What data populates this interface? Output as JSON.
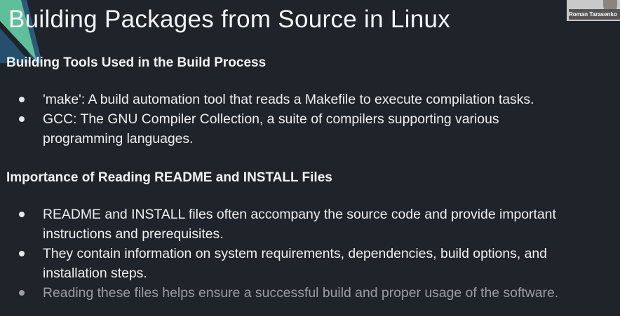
{
  "slide": {
    "title": "Building Packages from Source in Linux",
    "accent_color": "#5fbf9a",
    "sections": [
      {
        "heading": "Building Tools Used in the Build Process",
        "bullets": [
          {
            "lines": [
              "'make': A build automation tool that reads a Makefile to execute compilation tasks."
            ]
          },
          {
            "lines": [
              "GCC: The GNU Compiler Collection, a suite of compilers supporting various",
              "programming languages."
            ]
          }
        ]
      },
      {
        "heading": "Importance of Reading README and INSTALL Files",
        "bullets": [
          {
            "lines": [
              "README and INSTALL files often accompany the source code and provide important",
              "instructions and prerequisites."
            ]
          },
          {
            "lines": [
              "They contain information on system requirements, dependencies, build options, and",
              "installation steps."
            ]
          },
          {
            "lines": [
              "Reading these files helps ensure a successful build and proper usage of the software."
            ]
          }
        ]
      }
    ]
  },
  "video_overlay": {
    "participant_name": "Roman Tarasenko"
  }
}
